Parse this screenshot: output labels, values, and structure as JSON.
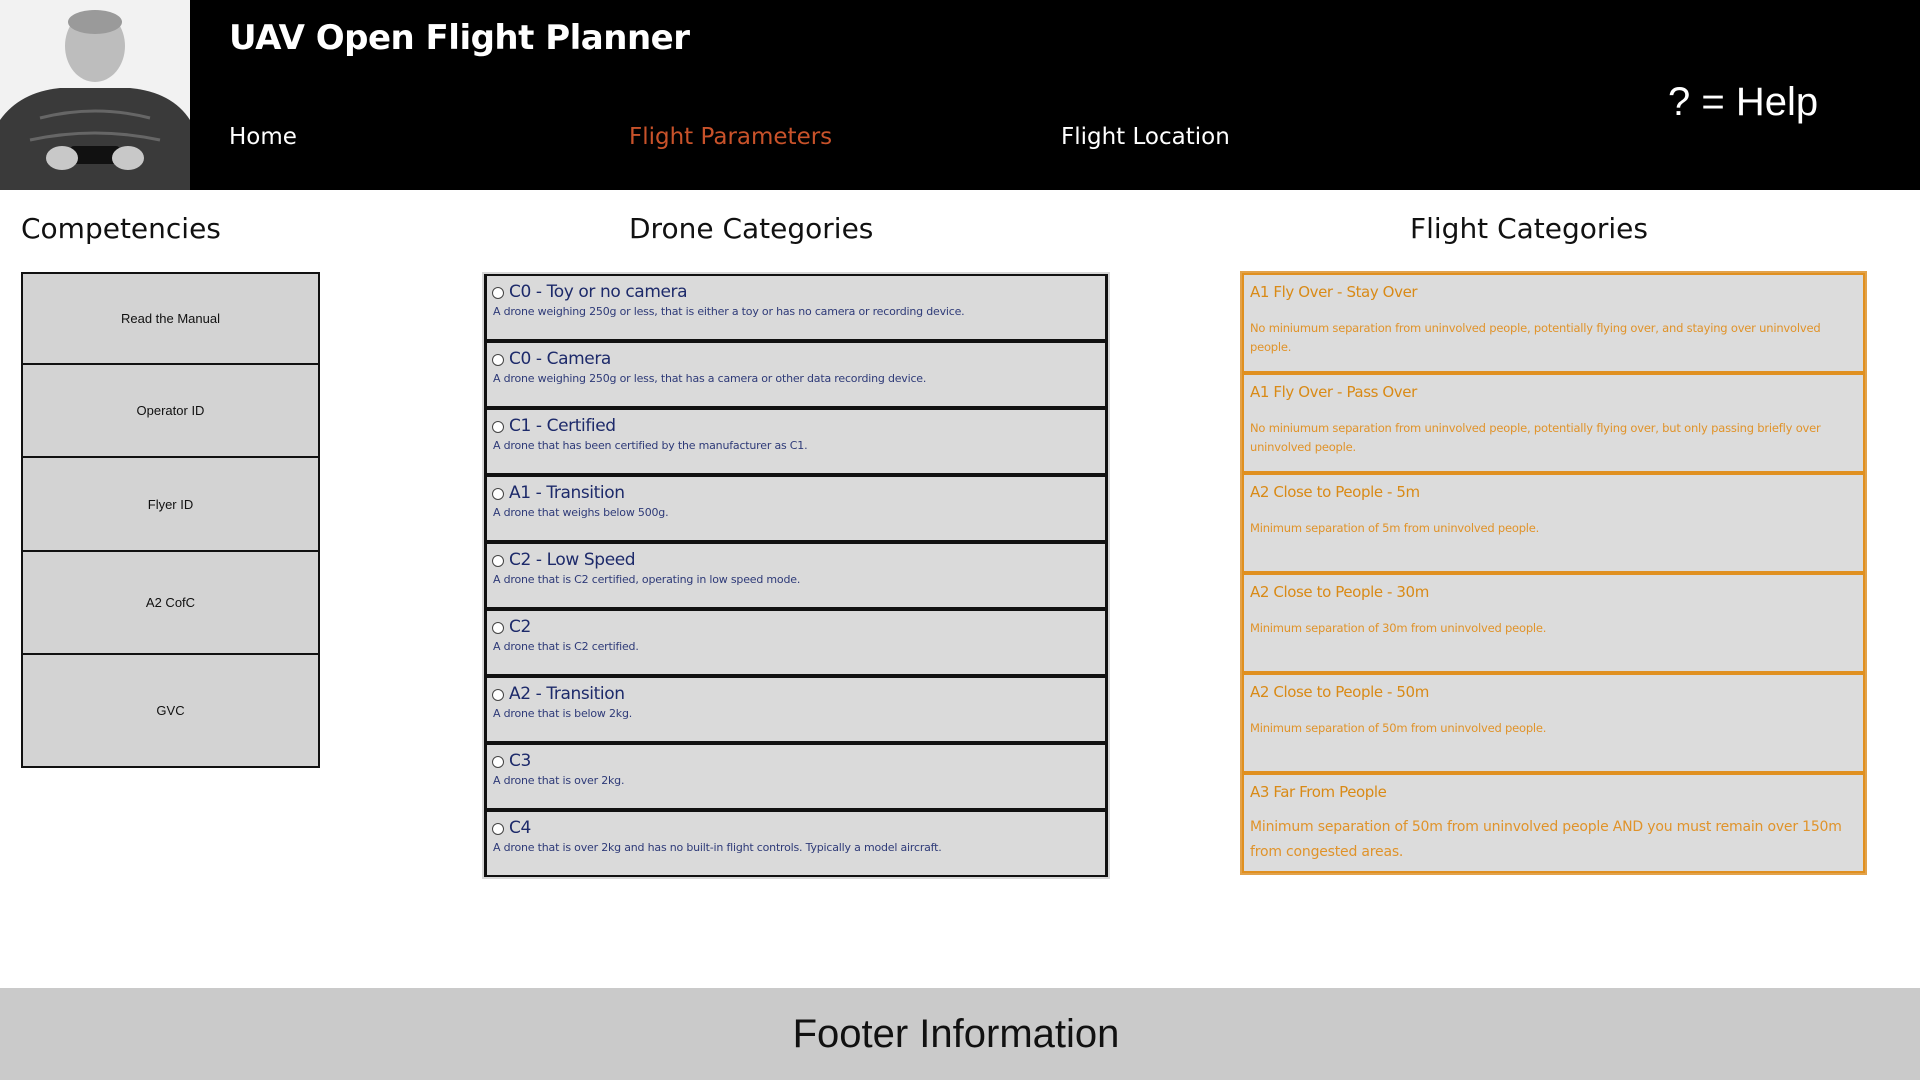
{
  "header": {
    "title": "UAV Open Flight Planner",
    "help": "? = Help",
    "nav": [
      {
        "label": "Home",
        "active": false
      },
      {
        "label": "Flight Parameters",
        "active": true
      },
      {
        "label": "Flight Location",
        "active": false
      }
    ],
    "accent_color": "#c8522a"
  },
  "competencies": {
    "heading": "Competencies",
    "items": [
      "Read the Manual",
      "Operator ID",
      "Flyer ID",
      "A2 CofC",
      "GVC"
    ]
  },
  "drone_categories": {
    "heading": "Drone Categories",
    "items": [
      {
        "title": "C0 - Toy or no camera",
        "desc": "A drone weighing 250g or less, that is either a toy or has no camera or recording device."
      },
      {
        "title": "C0 - Camera",
        "desc": "A drone weighing 250g or less, that has a camera or other data recording device."
      },
      {
        "title": "C1 - Certified",
        "desc": "A drone that has been certified by the manufacturer as C1."
      },
      {
        "title": "A1 - Transition",
        "desc": "A drone that weighs below 500g."
      },
      {
        "title": "C2 - Low Speed",
        "desc": "A drone that is C2 certified, operating in low speed mode."
      },
      {
        "title": "C2",
        "desc": "A drone that is C2 certified."
      },
      {
        "title": "A2 - Transition",
        "desc": "A drone that is below 2kg."
      },
      {
        "title": "C3",
        "desc": "A drone that is over 2kg."
      },
      {
        "title": "C4",
        "desc": "A drone that is over 2kg and has no built-in flight controls. Typically a model aircraft."
      }
    ]
  },
  "flight_categories": {
    "heading": "Flight Categories",
    "color": "#e09020",
    "items": [
      {
        "title": "A1 Fly Over - Stay Over",
        "desc": "No miniumum separation from uninvolved people, potentially flying over, and staying over uninvolved people."
      },
      {
        "title": "A1 Fly Over - Pass Over",
        "desc": "No miniumum separation from uninvolved people, potentially flying over, but only passing briefly over uninvolved people."
      },
      {
        "title": "A2 Close to People - 5m",
        "desc": "Minimum separation of 5m from uninvolved people."
      },
      {
        "title": "A2 Close to People - 30m",
        "desc": "Minimum separation of 30m from uninvolved people."
      },
      {
        "title": "A2 Close to People - 50m",
        "desc": "Minimum separation of 50m from uninvolved people."
      },
      {
        "title": "A3 Far From People",
        "desc": "Minimum separation of 50m from uninvolved people AND you must remain over 150m from congested areas."
      }
    ]
  },
  "footer": {
    "text": "Footer Information"
  }
}
